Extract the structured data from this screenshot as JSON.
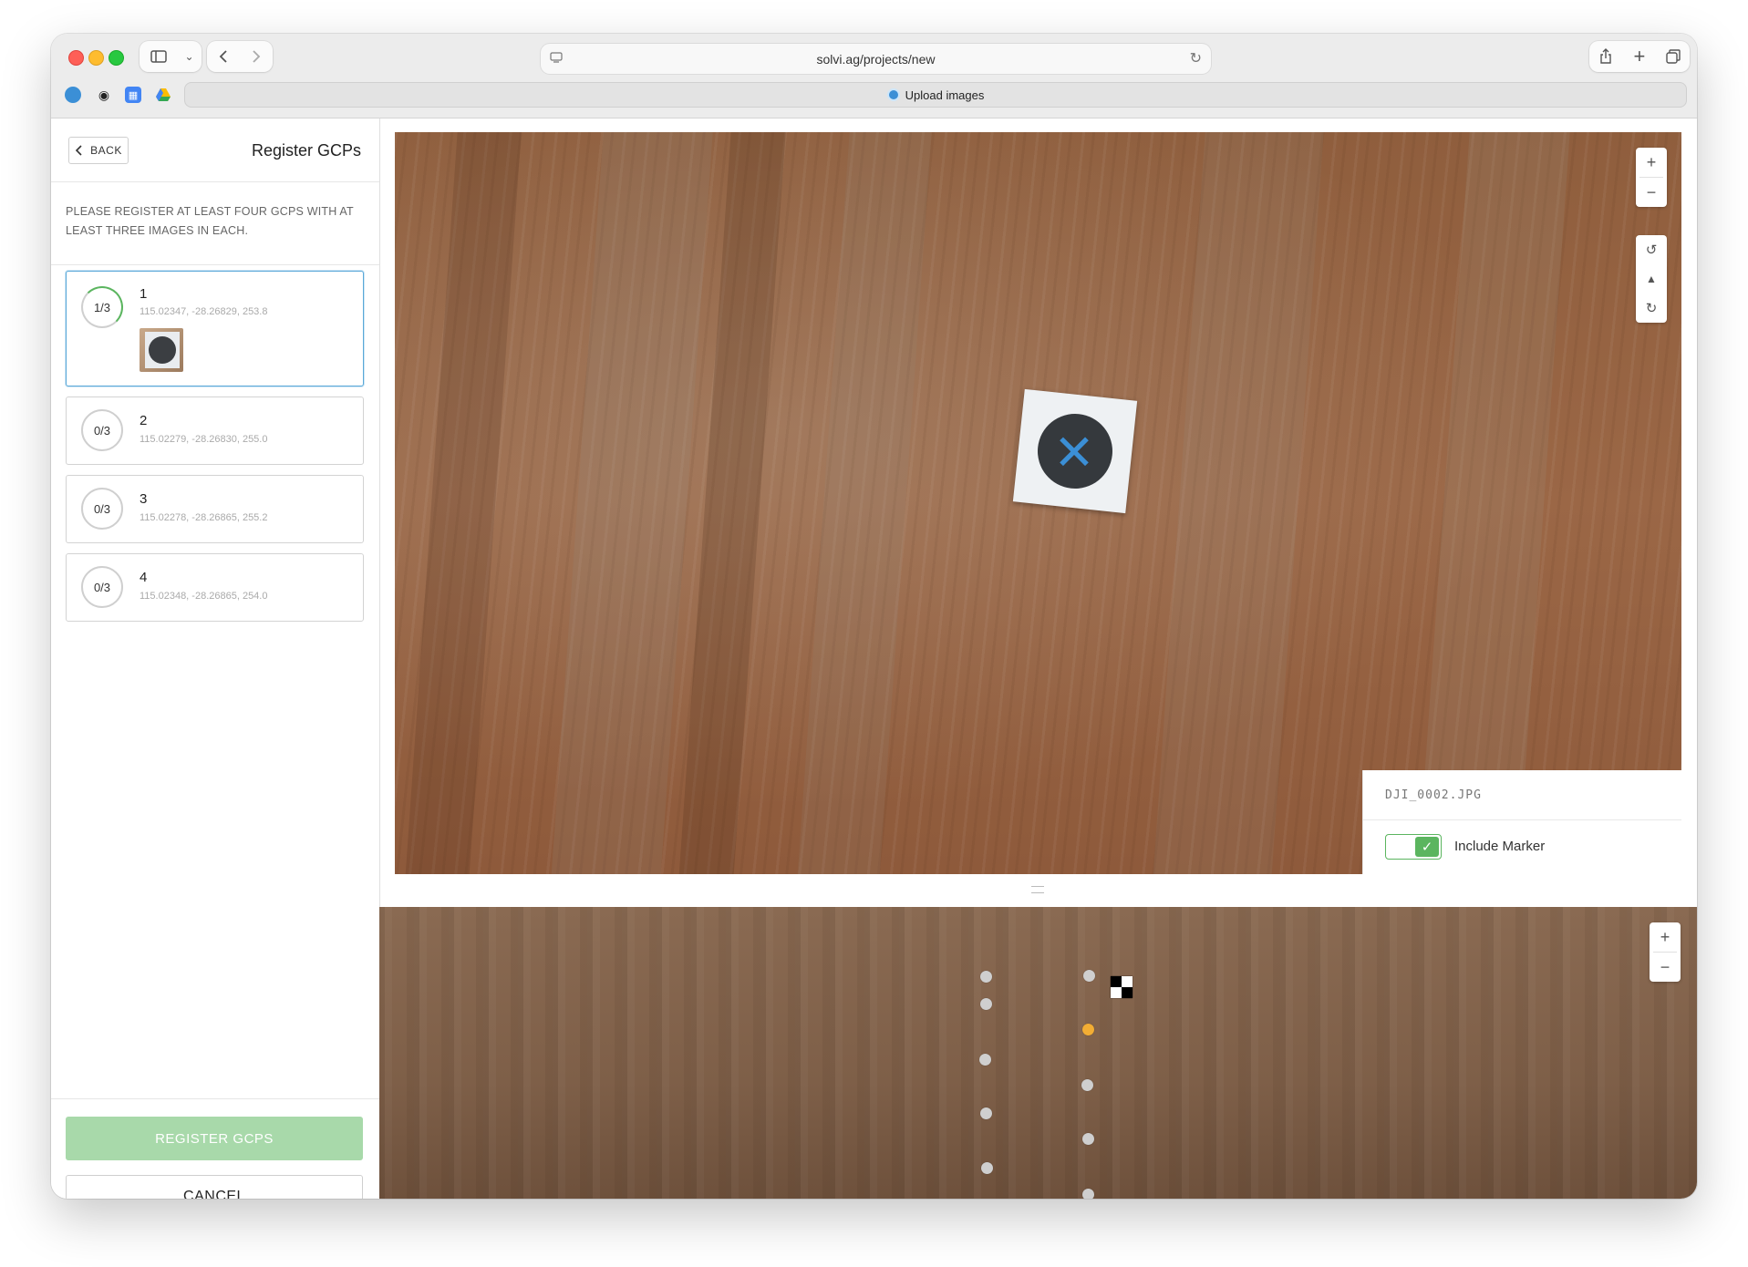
{
  "browser": {
    "url": "solvi.ag/projects/new",
    "tab_title": "Upload images"
  },
  "sidebar": {
    "back_label": "BACK",
    "title": "Register GCPs",
    "instructions": "PLEASE REGISTER AT LEAST FOUR GCPS WITH AT LEAST THREE IMAGES IN EACH.",
    "gcps": [
      {
        "progress": "1/3",
        "name": "1",
        "coords": "115.02347, -28.26829, 253.8"
      },
      {
        "progress": "0/3",
        "name": "2",
        "coords": "115.02279, -28.26830, 255.0"
      },
      {
        "progress": "0/3",
        "name": "3",
        "coords": "115.02278, -28.26865, 255.2"
      },
      {
        "progress": "0/3",
        "name": "4",
        "coords": "115.02348, -28.26865, 254.0"
      }
    ],
    "register_label": "REGISTER GCPS",
    "cancel_label": "CANCEL"
  },
  "image_view": {
    "filename": "DJI_0002.JPG",
    "include_marker_label": "Include Marker",
    "include_marker": true
  },
  "colors": {
    "accent_green": "#5bb55f",
    "register_disabled": "#a8d9aa",
    "marker_blue": "#3b8fd6",
    "active_dot": "#f2ad34"
  }
}
